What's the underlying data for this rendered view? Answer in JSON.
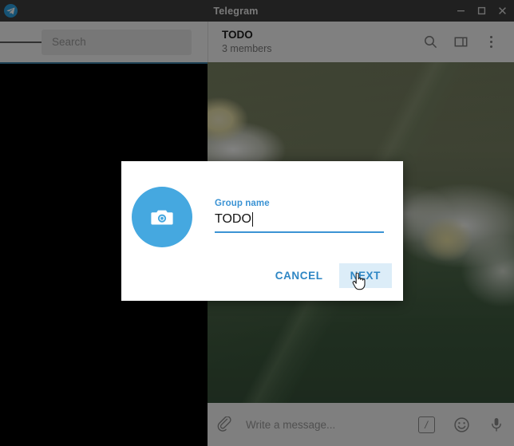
{
  "window": {
    "title": "Telegram",
    "logo_icon": "telegram-plane-icon",
    "controls": {
      "minimize": "minimize-icon",
      "maximize": "maximize-icon",
      "close": "close-icon"
    }
  },
  "sidebar": {
    "menu_icon": "hamburger-menu-icon",
    "search": {
      "placeholder": "Search",
      "value": ""
    }
  },
  "chat_header": {
    "title": "TODO",
    "subtitle": "3 members",
    "icons": {
      "search": "search-icon",
      "panel": "split-panel-icon",
      "menu": "more-vertical-icon"
    }
  },
  "composer": {
    "attach_icon": "paperclip-icon",
    "placeholder": "Write a message...",
    "command_icon": "slash-command-icon",
    "command_glyph": "/",
    "emoji_icon": "smiley-icon",
    "mic_icon": "microphone-icon"
  },
  "dialog": {
    "avatar_icon": "camera-icon",
    "field": {
      "label": "Group name",
      "value": "TODO"
    },
    "cancel_label": "CANCEL",
    "next_label": "NEXT",
    "next_hovered": true
  },
  "colors": {
    "accent_blue": "#3b93d4",
    "avatar_blue": "#45a8e0",
    "button_blue": "#2e86c4",
    "hover_bg": "#dcedf8",
    "titlebar_bg": "#3f3f3f",
    "header_bg": "#f5f5f5",
    "sidebar_bg": "#000000",
    "accent_line": "#3b7da3"
  }
}
